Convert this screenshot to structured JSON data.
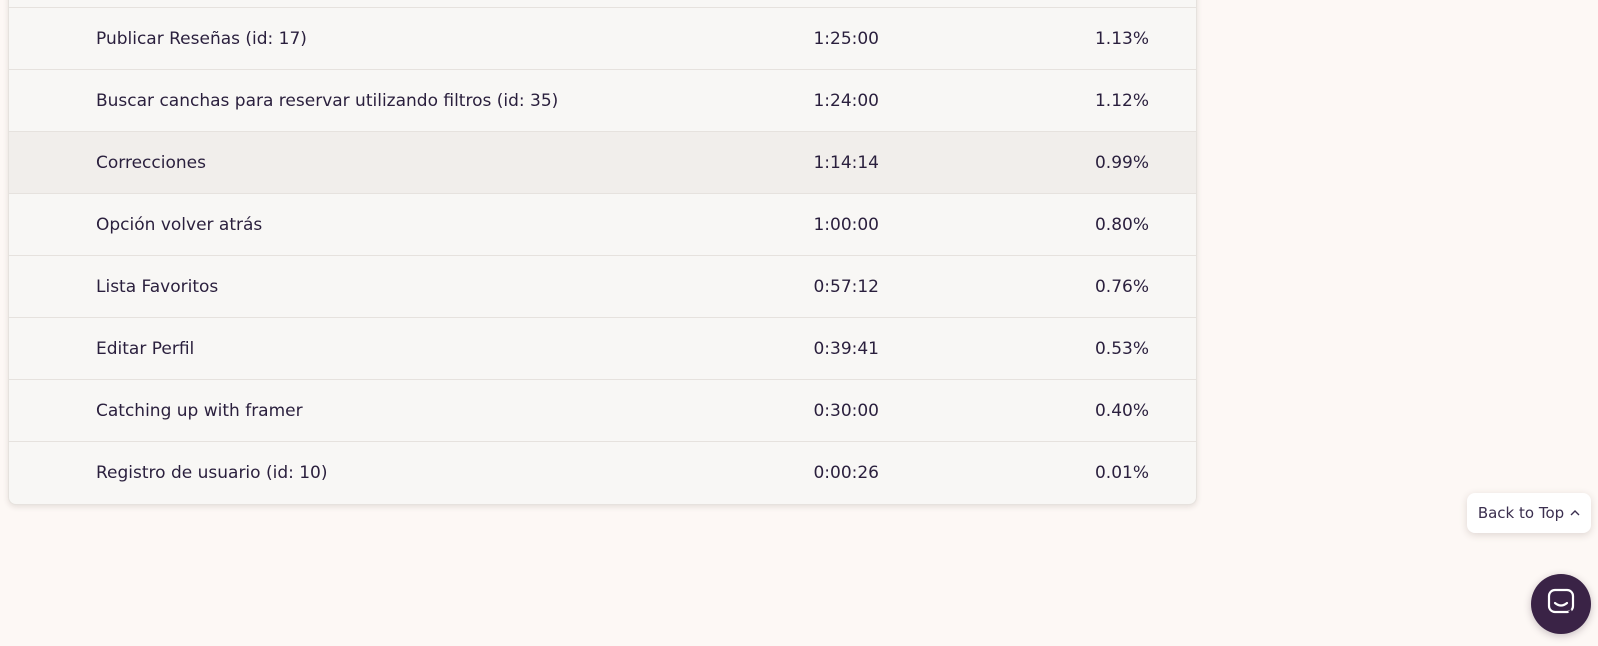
{
  "table": {
    "rows": [
      {
        "name": "Publicar Reseñas (id: 17)",
        "time": "1:25:00",
        "percent": "1.13%"
      },
      {
        "name": "Buscar canchas para reservar utilizando filtros (id: 35)",
        "time": "1:24:00",
        "percent": "1.12%"
      },
      {
        "name": "Correcciones",
        "time": "1:14:14",
        "percent": "0.99%",
        "hovered": true
      },
      {
        "name": "Opción volver atrás",
        "time": "1:00:00",
        "percent": "0.80%"
      },
      {
        "name": "Lista Favoritos",
        "time": "0:57:12",
        "percent": "0.76%"
      },
      {
        "name": "Editar Perfil",
        "time": "0:39:41",
        "percent": "0.53%"
      },
      {
        "name": "Catching up with framer",
        "time": "0:30:00",
        "percent": "0.40%"
      },
      {
        "name": "Registro de usuario (id: 10)",
        "time": "0:00:26",
        "percent": "0.01%"
      }
    ]
  },
  "back_to_top": {
    "label": "Back to Top",
    "icon": "chevron-up-icon"
  },
  "chat_launcher": {
    "icon": "chat-icon",
    "color": "#3a2346"
  },
  "colors": {
    "background": "#fdf8f5",
    "table_background": "#f8f7f5",
    "row_hover": "#f1eeeb",
    "text": "#2a1f3d"
  }
}
